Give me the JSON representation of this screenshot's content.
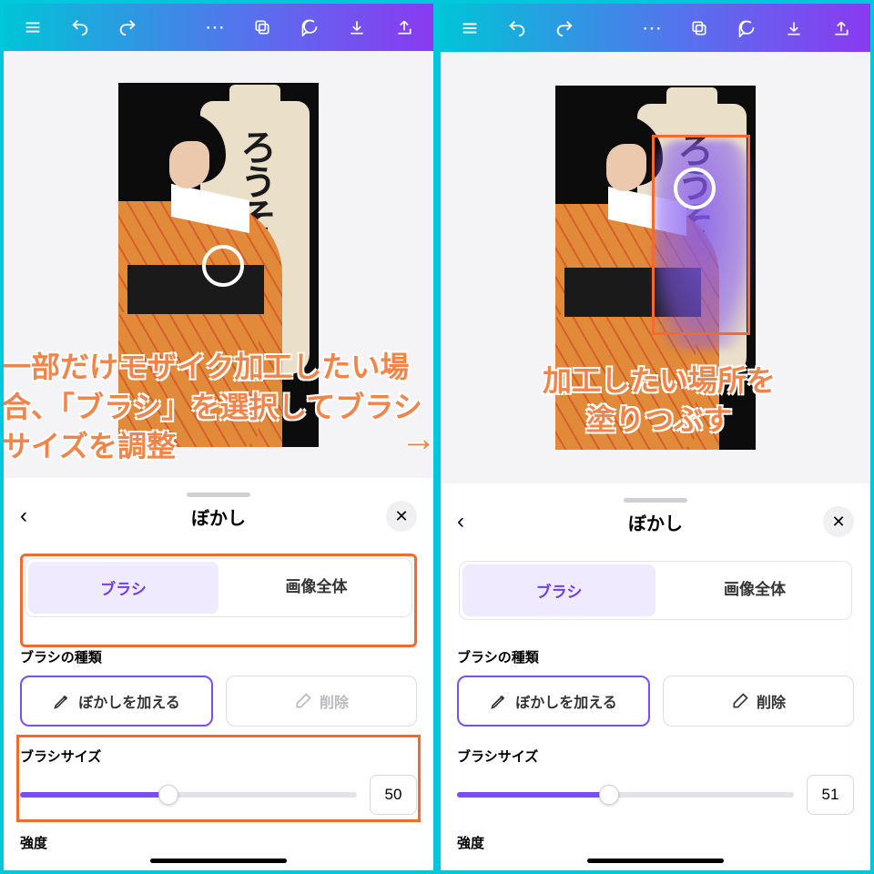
{
  "toolbar": {
    "items": [
      "menu",
      "undo",
      "redo",
      "more",
      "copy",
      "comment",
      "download",
      "share"
    ]
  },
  "panel": {
    "title": "ぼかし",
    "back": "‹",
    "close": "✕",
    "tabs": {
      "brush": "ブラシ",
      "whole": "画像全体"
    },
    "brush_type_label": "ブラシの種類",
    "tool_add": "ぼかしを加える",
    "tool_erase": "削除",
    "size_label": "ブラシサイズ",
    "intensity_label": "強度"
  },
  "left": {
    "note": "一部だけモザイク加工したい場合、「ブラシ」を選択してブラシサイズを調整",
    "brush_size": "50",
    "fill_pct": 44
  },
  "right": {
    "note": "加工したい場所を\n塗りつぶす",
    "brush_size": "51",
    "fill_pct": 45
  },
  "banner_text": "ろうそく"
}
